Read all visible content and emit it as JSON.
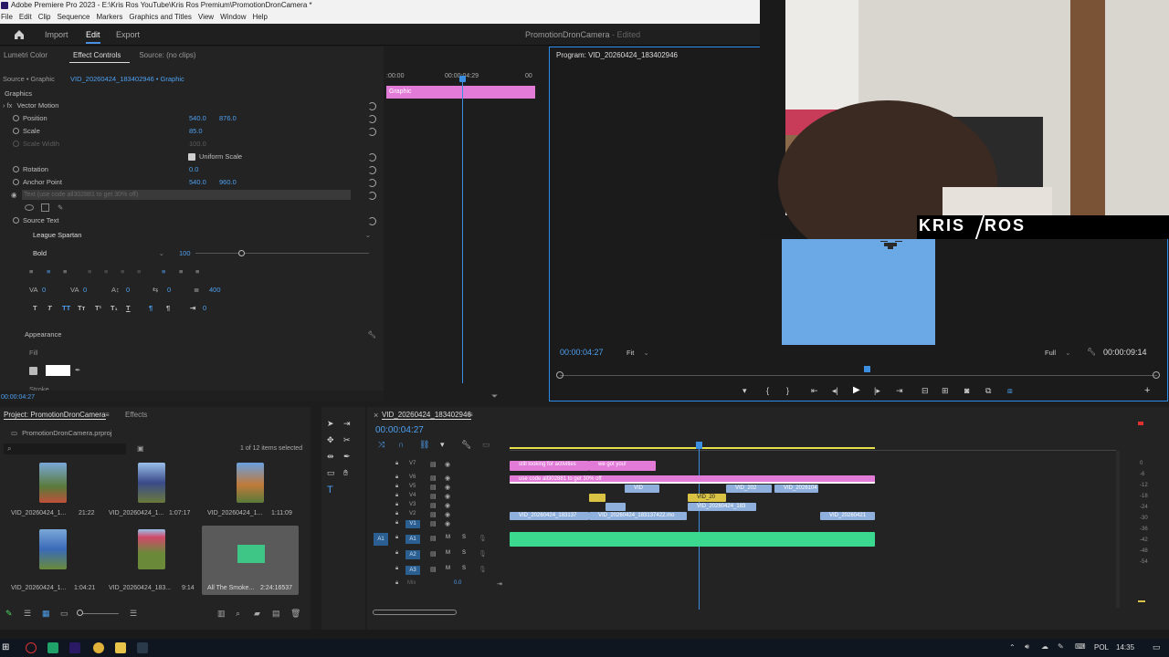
{
  "titlebar": {
    "title": "Adobe Premiere Pro 2023 - E:\\Kris Ros YouTube\\Kris Ros Premium\\PromotionDronCamera *"
  },
  "menu": [
    "File",
    "Edit",
    "Clip",
    "Sequence",
    "Markers",
    "Graphics and Titles",
    "View",
    "Window",
    "Help"
  ],
  "nav": {
    "import": "Import",
    "edit": "Edit",
    "export": "Export",
    "project_name": "PromotionDronCamera",
    "edited": "- Edited"
  },
  "effect_controls": {
    "tabs": [
      "Lumetri Color",
      "Effect Controls",
      "Source: (no clips)"
    ],
    "source": "Source • Graphic",
    "clip": "VID_20260424_183402946 • Graphic",
    "ruler_start": ":00:00",
    "ruler_mid": "00:00:04:29",
    "ruler_end": "00",
    "graphic_clip_label": "Graphic",
    "section": "Graphics",
    "vector_motion": "Vector Motion",
    "position_label": "Position",
    "position_x": "540.0",
    "position_y": "876.0",
    "scale_label": "Scale",
    "scale_value": "85.0",
    "scale_width_label": "Scale Width",
    "scale_width_value": "100.0",
    "uniform_scale": "Uniform Scale",
    "rotation_label": "Rotation",
    "rotation_value": "0.0",
    "anchor_label": "Anchor Point",
    "anchor_x": "540.0",
    "anchor_y": "960.0",
    "text_layer": "Text (use code all302881 to get 30% off)",
    "source_text": "Source Text",
    "font": "League Spartan",
    "font_style": "Bold",
    "font_size": "100",
    "tracking_a": "0",
    "tracking_b": "0",
    "baseline": "0",
    "tsume": "0",
    "leading": "400",
    "indent": "0",
    "appearance": "Appearance",
    "fill": "Fill",
    "stroke": "Stroke",
    "timecode": "00:00:04:27"
  },
  "program": {
    "title": "Program: VID_20260424_183402946",
    "timecode": "00:00:04:27",
    "fit": "Fit",
    "quality": "Full",
    "duration": "00:00:09:14"
  },
  "overlay": {
    "brand_left": "KRIS",
    "brand_right": "ROS"
  },
  "project": {
    "tabs": [
      "Project: PromotionDronCamera",
      "Effects"
    ],
    "file": "PromotionDronCamera.prproj",
    "selection": "1 of 12 items selected",
    "items": [
      {
        "name": "VID_20260424_1...",
        "dur": "21:22"
      },
      {
        "name": "VID_20260424_1...",
        "dur": "1:07:17"
      },
      {
        "name": "VID_20260424_1...",
        "dur": "1:11:09"
      },
      {
        "name": "VID_20260424_1...",
        "dur": "1:04:21"
      },
      {
        "name": "VID_20260424_183...",
        "dur": "9:14"
      },
      {
        "name": "All The Smoke...",
        "dur": "2:24:16537"
      }
    ]
  },
  "timeline": {
    "sequence": "VID_20260424_183402946",
    "timecode": "00:00:04:27",
    "tracks_v": [
      "V7",
      "V6",
      "V5",
      "V4",
      "V3",
      "V2",
      "V1"
    ],
    "tracks_a": [
      "A1",
      "A2",
      "A3"
    ],
    "mix": "Mix",
    "mix_value": "0.0",
    "clips": {
      "v7a": "still looking for activities",
      "v7b": "we got you!",
      "v6": "use code all302881 to get 30% off",
      "v5a": "VID",
      "v5b": "VID_202",
      "v5c": "VID_2026104",
      "v4": "VID_20",
      "v3": "VID_20260424_183",
      "v2a": "VID_20260424_183137",
      "v2b": "VID_20260424_183137422.mo",
      "v2c": "VID_20260421"
    },
    "meter": [
      "0",
      "-6",
      "-12",
      "-18",
      "-24",
      "-30",
      "-36",
      "-42",
      "-48",
      "-54"
    ]
  },
  "taskbar": {
    "lang": "POL",
    "time": "14:35"
  },
  "colors": {
    "accent": "#2d8ceb",
    "pink_clip": "#e27ad8",
    "audio_clip": "#3ad98f",
    "sky": "#6aa8e6"
  }
}
